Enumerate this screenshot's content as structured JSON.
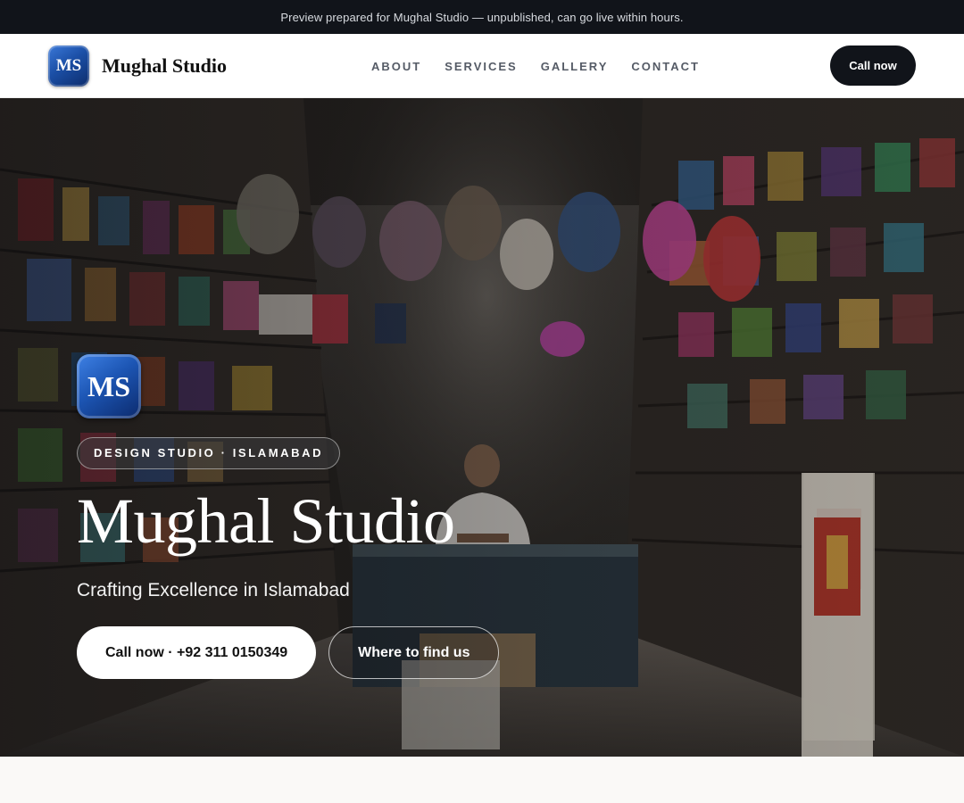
{
  "announcement": {
    "text": "Preview prepared for Mughal Studio — unpublished, can go live within hours."
  },
  "header": {
    "logo_initials": "MS",
    "brand_name": "Mughal Studio",
    "nav": [
      {
        "label": "ABOUT"
      },
      {
        "label": "SERVICES"
      },
      {
        "label": "GALLERY"
      },
      {
        "label": "CONTACT"
      }
    ],
    "call_label": "Call now"
  },
  "hero": {
    "logo_initials": "MS",
    "eyebrow": "DESIGN STUDIO · ISLAMABAD",
    "title": "Mughal Studio",
    "subtitle": "Crafting Excellence in Islamabad",
    "primary_cta": "Call now · +92 311 0150349",
    "secondary_cta": "Where to find us",
    "background_image": "shop-interior-photo"
  },
  "colors": {
    "dark": "#11141a",
    "logo_blue": "#1b4fa6",
    "white": "#ffffff"
  }
}
